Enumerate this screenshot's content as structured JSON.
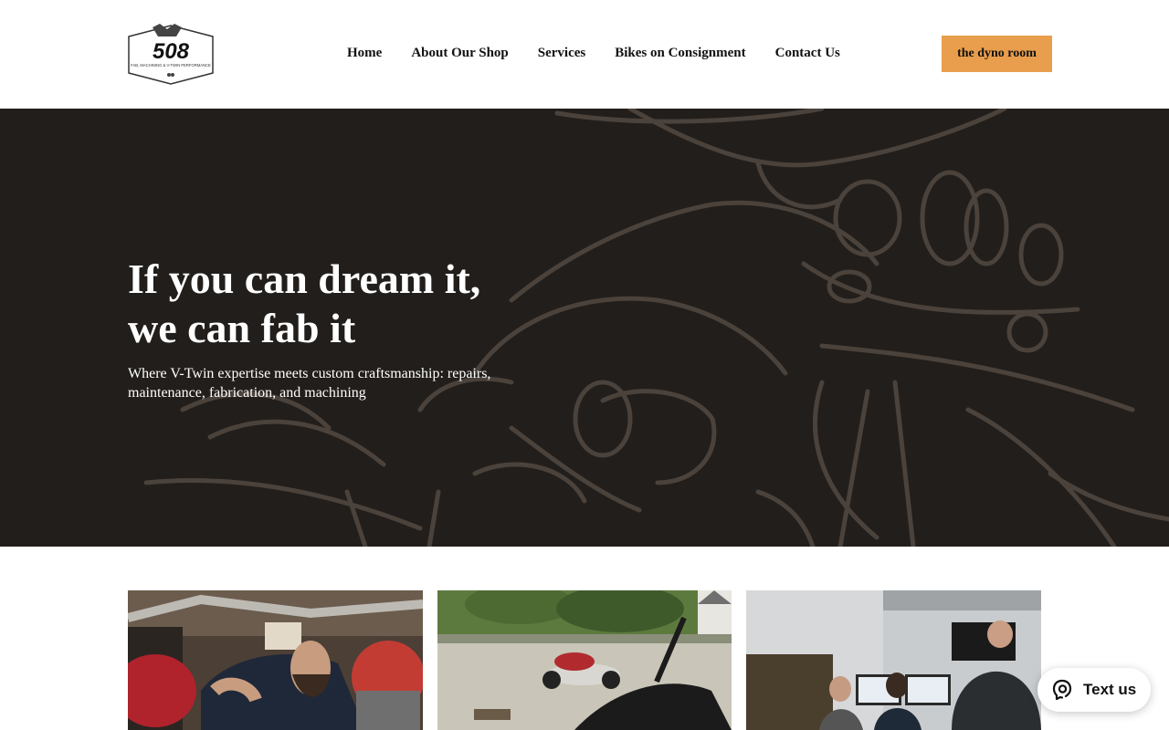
{
  "header": {
    "logo_text": "508",
    "logo_tagline": "FAB, MACHINING & V-TWIN PERFORMANCE",
    "nav": [
      {
        "label": "Home"
      },
      {
        "label": "About Our Shop"
      },
      {
        "label": "Services"
      },
      {
        "label": "Bikes on Consignment"
      },
      {
        "label": "Contact Us"
      }
    ],
    "cta_label": "the dyno room"
  },
  "hero": {
    "title": "If you can dream it, we can fab it",
    "subtitle": "Where V-Twin expertise meets custom craftsmanship: repairs, maintenance, fabrication, and machining"
  },
  "cards": [
    {
      "icon": "mechanic-photo"
    },
    {
      "icon": "motorcycles-photo"
    },
    {
      "icon": "dyno-room-photo"
    }
  ],
  "widget": {
    "label": "Text us",
    "icon": "chat-bubble-icon"
  },
  "colors": {
    "hero_bg": "#221e1b",
    "hero_art": "#4a423b",
    "accent": "#e89e4c"
  }
}
